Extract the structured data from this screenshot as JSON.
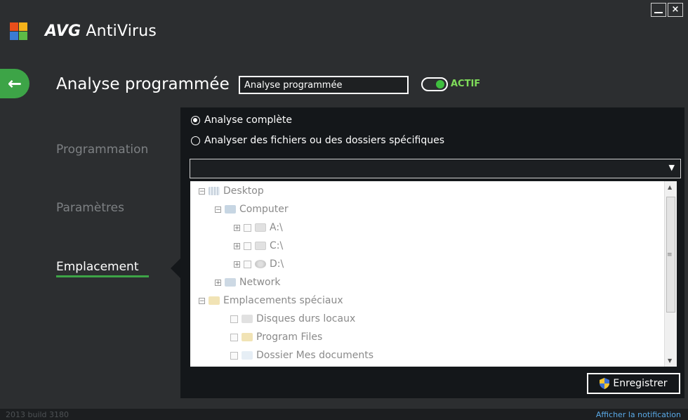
{
  "app": {
    "brand_bold": "AVG",
    "brand_name": "AntiVirus",
    "close_glyph": "×"
  },
  "header": {
    "title": "Analyse programmée",
    "name_value": "Analyse programmée",
    "toggle_label": "ACTIF",
    "back_glyph": "←"
  },
  "nav": {
    "items": [
      {
        "label": "Programmation",
        "active": false
      },
      {
        "label": "Paramètres",
        "active": false
      },
      {
        "label": "Emplacement",
        "active": true
      }
    ]
  },
  "scan_options": {
    "full": "Analyse complète",
    "specific": "Analyser des fichiers ou des dossiers spécifiques",
    "selected": "full"
  },
  "path_select": {
    "value": "",
    "arrow": "▼"
  },
  "tree": {
    "nodes": [
      {
        "label": "Desktop",
        "expander": "−",
        "checkbox": false
      },
      {
        "label": "Computer",
        "expander": "−",
        "checkbox": false
      },
      {
        "label": "A:\\",
        "expander": "+",
        "checkbox": true
      },
      {
        "label": "C:\\",
        "expander": "+",
        "checkbox": true
      },
      {
        "label": "D:\\",
        "expander": "+",
        "checkbox": true
      },
      {
        "label": "Network",
        "expander": "+",
        "checkbox": false
      },
      {
        "label": "Emplacements spéciaux",
        "expander": "−",
        "checkbox": false
      },
      {
        "label": "Disques durs locaux",
        "expander": "",
        "checkbox": true
      },
      {
        "label": "Program Files",
        "expander": "",
        "checkbox": true
      },
      {
        "label": "Dossier Mes documents",
        "expander": "",
        "checkbox": true
      }
    ]
  },
  "actions": {
    "save": "Enregistrer"
  },
  "status": {
    "build": "2013 build 3180",
    "notification": "Afficher la notification"
  },
  "colors": {
    "accent": "#3da447",
    "toggle_on": "#7fdc5a",
    "link": "#5aa9e6"
  }
}
